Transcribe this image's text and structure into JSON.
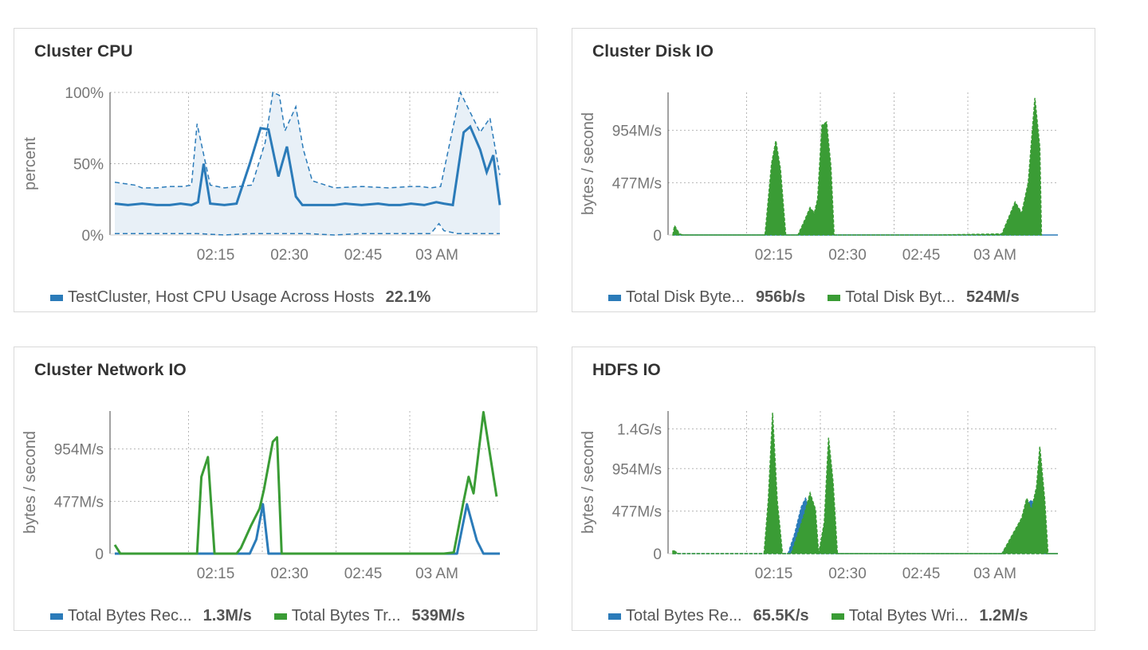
{
  "colors": {
    "blue": "#2b7bb9",
    "green": "#3a9c35",
    "grid": "#b5b5b5",
    "axis": "#444444",
    "band": "#e8f0f7"
  },
  "x_ticks": [
    "02:15",
    "02:30",
    "02:45",
    "03 AM"
  ],
  "panels": [
    {
      "title": "Cluster CPU",
      "legend": [
        {
          "label": "TestCluster, Host CPU Usage Across Hosts",
          "value": "22.1%",
          "color": "#2b7bb9"
        }
      ]
    },
    {
      "title": "Cluster Disk IO",
      "legend": [
        {
          "label": "Total Disk Byte...",
          "value": "956b/s",
          "color": "#2b7bb9"
        },
        {
          "label": "Total Disk Byt...",
          "value": "524M/s",
          "color": "#3a9c35"
        }
      ]
    },
    {
      "title": "Cluster Network IO",
      "legend": [
        {
          "label": "Total Bytes Rec...",
          "value": "1.3M/s",
          "color": "#2b7bb9"
        },
        {
          "label": "Total Bytes Tr...",
          "value": "539M/s",
          "color": "#3a9c35"
        }
      ]
    },
    {
      "title": "HDFS IO",
      "legend": [
        {
          "label": "Total Bytes Re...",
          "value": "65.5K/s",
          "color": "#2b7bb9"
        },
        {
          "label": "Total Bytes Wri...",
          "value": "1.2M/s",
          "color": "#3a9c35"
        }
      ]
    }
  ],
  "chart_data": [
    {
      "type": "line",
      "title": "Cluster CPU",
      "ylabel": "percent",
      "y_ticks": [
        "0%",
        "50%",
        "100%"
      ],
      "ylim": [
        0,
        100
      ],
      "x_ticks": [
        "02:15",
        "02:30",
        "02:45",
        "03 AM"
      ],
      "xlim": [
        0,
        0.3
      ],
      "series": [
        {
          "name": "TestCluster, Host CPU Usage Across Hosts",
          "color": "#2b7bb9",
          "style": "line",
          "band_max": [
            [
              0,
              37
            ],
            [
              0.06,
              35
            ],
            [
              0.083,
              33
            ],
            [
              0.127,
              33
            ],
            [
              0.167,
              34
            ],
            [
              0.21,
              34
            ],
            [
              0.233,
              35
            ],
            [
              0.25,
              78
            ],
            [
              0.29,
              35
            ],
            [
              0.333,
              33
            ],
            [
              0.417,
              35
            ],
            [
              0.457,
              65
            ],
            [
              0.48,
              100
            ],
            [
              0.5,
              98
            ],
            [
              0.517,
              73
            ],
            [
              0.55,
              90
            ],
            [
              0.573,
              60
            ],
            [
              0.6,
              38
            ],
            [
              0.667,
              33
            ],
            [
              0.75,
              34
            ],
            [
              0.833,
              33
            ],
            [
              0.9,
              34
            ],
            [
              0.93,
              34
            ],
            [
              0.96,
              33
            ],
            [
              0.99,
              34
            ],
            [
              1.05,
              100
            ],
            [
              1.11,
              72
            ],
            [
              1.14,
              82
            ],
            [
              1.17,
              42
            ]
          ],
          "band_min": [
            [
              0,
              1
            ],
            [
              0.1,
              1
            ],
            [
              0.2,
              1
            ],
            [
              0.25,
              1
            ],
            [
              0.333,
              0
            ],
            [
              0.417,
              1
            ],
            [
              0.5,
              1
            ],
            [
              0.583,
              1
            ],
            [
              0.667,
              0
            ],
            [
              0.75,
              1
            ],
            [
              0.833,
              1
            ],
            [
              0.9,
              1
            ],
            [
              0.96,
              1
            ],
            [
              0.985,
              8
            ],
            [
              1.0,
              3
            ],
            [
              1.04,
              1
            ],
            [
              1.1,
              1
            ],
            [
              1.17,
              1
            ]
          ],
          "values": [
            [
              0,
              22
            ],
            [
              0.04,
              21
            ],
            [
              0.083,
              22
            ],
            [
              0.127,
              21
            ],
            [
              0.167,
              21
            ],
            [
              0.2,
              22
            ],
            [
              0.233,
              21
            ],
            [
              0.253,
              23
            ],
            [
              0.27,
              50
            ],
            [
              0.29,
              22
            ],
            [
              0.333,
              21
            ],
            [
              0.37,
              22
            ],
            [
              0.41,
              50
            ],
            [
              0.443,
              75
            ],
            [
              0.467,
              74
            ],
            [
              0.497,
              41
            ],
            [
              0.523,
              62
            ],
            [
              0.55,
              27
            ],
            [
              0.57,
              21
            ],
            [
              0.6,
              21
            ],
            [
              0.667,
              21
            ],
            [
              0.7,
              22
            ],
            [
              0.75,
              21
            ],
            [
              0.8,
              22
            ],
            [
              0.833,
              21
            ],
            [
              0.867,
              21
            ],
            [
              0.9,
              22
            ],
            [
              0.94,
              21
            ],
            [
              0.977,
              23
            ],
            [
              1.0,
              22
            ],
            [
              1.027,
              21
            ],
            [
              1.06,
              72
            ],
            [
              1.08,
              76
            ],
            [
              1.11,
              60
            ],
            [
              1.13,
              44
            ],
            [
              1.15,
              56
            ],
            [
              1.17,
              21
            ]
          ]
        }
      ]
    },
    {
      "type": "area",
      "title": "Cluster Disk IO",
      "ylabel": "bytes / second",
      "y_ticks": [
        "0",
        "477M/s",
        "954M/s"
      ],
      "y_tick_values": [
        0,
        477,
        954
      ],
      "ylim": [
        0,
        1300
      ],
      "x_ticks": [
        "02:15",
        "02:30",
        "02:45",
        "03 AM"
      ],
      "series": [
        {
          "name": "Total Disk Byte...",
          "color": "#2b7bb9",
          "values": [
            [
              0,
              0
            ],
            [
              1.17,
              0
            ]
          ]
        },
        {
          "name": "Total Disk Byt...",
          "color": "#3a9c35",
          "values": [
            [
              0,
              0
            ],
            [
              0.005,
              85
            ],
            [
              0.02,
              10
            ],
            [
              0.03,
              0
            ],
            [
              0.2,
              0
            ],
            [
              0.28,
              0
            ],
            [
              0.3,
              650
            ],
            [
              0.313,
              860
            ],
            [
              0.327,
              600
            ],
            [
              0.343,
              0
            ],
            [
              0.38,
              0
            ],
            [
              0.4,
              130
            ],
            [
              0.417,
              250
            ],
            [
              0.43,
              200
            ],
            [
              0.44,
              330
            ],
            [
              0.453,
              1000
            ],
            [
              0.467,
              1030
            ],
            [
              0.48,
              630
            ],
            [
              0.49,
              0
            ],
            [
              0.6,
              0
            ],
            [
              0.8,
              0
            ],
            [
              1.0,
              10
            ],
            [
              1.04,
              300
            ],
            [
              1.06,
              200
            ],
            [
              1.08,
              480
            ],
            [
              1.1,
              1250
            ],
            [
              1.115,
              800
            ],
            [
              1.12,
              0
            ]
          ]
        }
      ]
    },
    {
      "type": "line",
      "title": "Cluster Network IO",
      "ylabel": "bytes / second",
      "y_ticks": [
        "0",
        "477M/s",
        "954M/s"
      ],
      "y_tick_values": [
        0,
        477,
        954
      ],
      "ylim": [
        0,
        1300
      ],
      "x_ticks": [
        "02:15",
        "02:30",
        "02:45",
        "03 AM"
      ],
      "series": [
        {
          "name": "Total Bytes Rec...",
          "color": "#2b7bb9",
          "values": [
            [
              0,
              0
            ],
            [
              0.25,
              0
            ],
            [
              0.37,
              0
            ],
            [
              0.41,
              0
            ],
            [
              0.43,
              130
            ],
            [
              0.45,
              450
            ],
            [
              0.467,
              0
            ],
            [
              0.5,
              0
            ],
            [
              1.04,
              0
            ],
            [
              1.07,
              450
            ],
            [
              1.1,
              120
            ],
            [
              1.12,
              0
            ],
            [
              1.17,
              0
            ]
          ]
        },
        {
          "name": "Total Bytes Tr...",
          "color": "#3a9c35",
          "values": [
            [
              0,
              80
            ],
            [
              0.017,
              0
            ],
            [
              0.25,
              0
            ],
            [
              0.263,
              700
            ],
            [
              0.283,
              880
            ],
            [
              0.303,
              0
            ],
            [
              0.37,
              0
            ],
            [
              0.383,
              50
            ],
            [
              0.413,
              250
            ],
            [
              0.44,
              410
            ],
            [
              0.453,
              580
            ],
            [
              0.48,
              1020
            ],
            [
              0.493,
              1060
            ],
            [
              0.507,
              0
            ],
            [
              0.6,
              0
            ],
            [
              0.8,
              0
            ],
            [
              1.0,
              0
            ],
            [
              1.03,
              10
            ],
            [
              1.06,
              480
            ],
            [
              1.075,
              700
            ],
            [
              1.09,
              550
            ],
            [
              1.12,
              1290
            ],
            [
              1.16,
              520
            ]
          ]
        }
      ]
    },
    {
      "type": "area",
      "title": "HDFS IO",
      "ylabel": "bytes / second",
      "y_ticks": [
        "0",
        "477M/s",
        "954M/s",
        "1.4G/s"
      ],
      "y_tick_values": [
        0,
        477,
        954,
        1400
      ],
      "ylim": [
        0,
        1600
      ],
      "x_ticks": [
        "02:15",
        "02:30",
        "02:45",
        "03 AM"
      ],
      "series": [
        {
          "name": "Total Bytes Re...",
          "color": "#2b7bb9",
          "values": [
            [
              0,
              0
            ],
            [
              0.35,
              0
            ],
            [
              0.37,
              220
            ],
            [
              0.39,
              520
            ],
            [
              0.403,
              620
            ],
            [
              0.417,
              500
            ],
            [
              0.433,
              200
            ],
            [
              0.44,
              0
            ],
            [
              0.6,
              0
            ],
            [
              1.0,
              0
            ],
            [
              1.06,
              300
            ],
            [
              1.075,
              550
            ],
            [
              1.09,
              600
            ],
            [
              1.11,
              400
            ],
            [
              1.12,
              150
            ],
            [
              1.13,
              0
            ],
            [
              1.17,
              0
            ]
          ]
        },
        {
          "name": "Total Bytes Wri...",
          "color": "#3a9c35",
          "values": [
            [
              0,
              40
            ],
            [
              0.017,
              0
            ],
            [
              0.2,
              0
            ],
            [
              0.277,
              0
            ],
            [
              0.29,
              600
            ],
            [
              0.303,
              1580
            ],
            [
              0.317,
              600
            ],
            [
              0.333,
              0
            ],
            [
              0.36,
              0
            ],
            [
              0.4,
              450
            ],
            [
              0.417,
              680
            ],
            [
              0.433,
              500
            ],
            [
              0.443,
              0
            ],
            [
              0.46,
              350
            ],
            [
              0.473,
              1300
            ],
            [
              0.487,
              800
            ],
            [
              0.5,
              0
            ],
            [
              0.55,
              0
            ],
            [
              1.0,
              0
            ],
            [
              1.06,
              400
            ],
            [
              1.075,
              620
            ],
            [
              1.09,
              500
            ],
            [
              1.105,
              750
            ],
            [
              1.115,
              1200
            ],
            [
              1.13,
              600
            ],
            [
              1.14,
              0
            ],
            [
              1.17,
              0
            ]
          ]
        }
      ]
    }
  ]
}
